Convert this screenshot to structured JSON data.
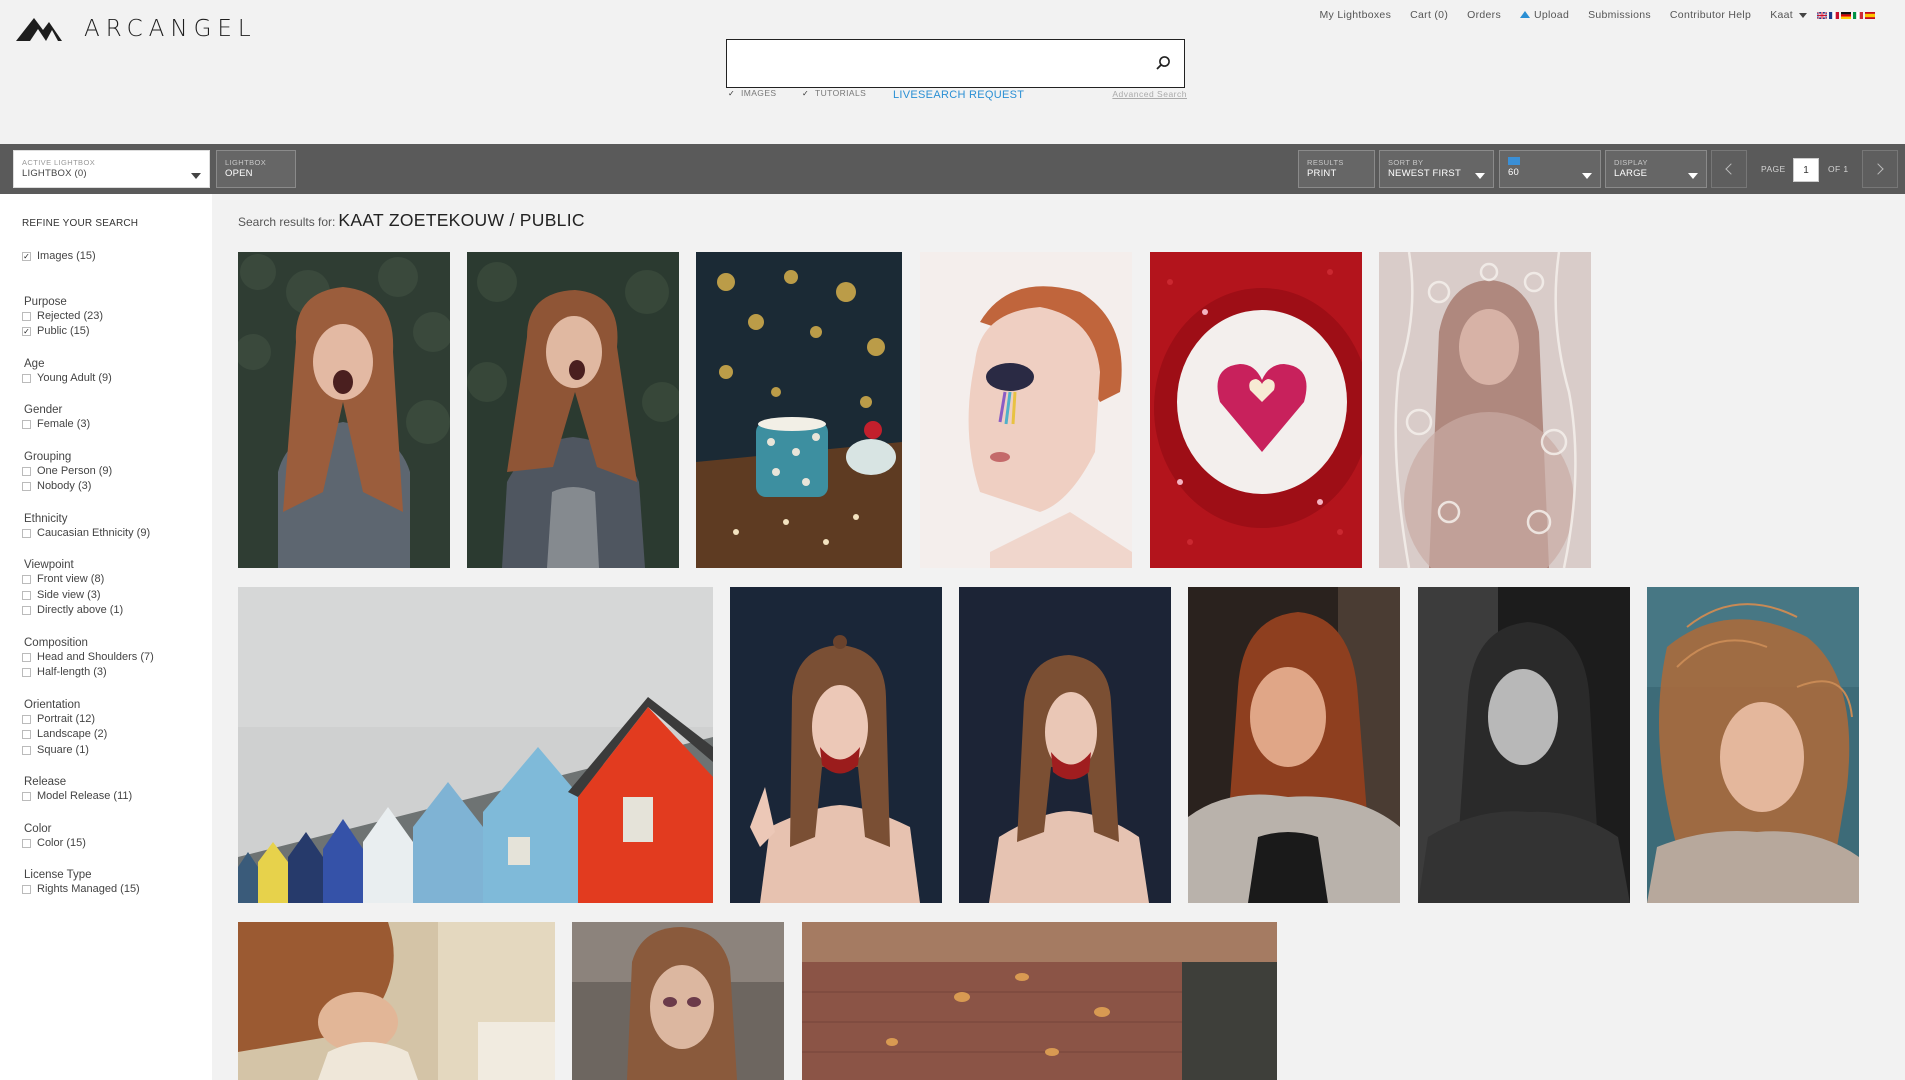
{
  "brand": {
    "name": "ARCANGEL"
  },
  "topnav": {
    "items": [
      "My Lightboxes",
      "Cart (0)",
      "Orders",
      "Upload",
      "Submissions",
      "Contributor Help"
    ],
    "user": "Kaat"
  },
  "search": {
    "placeholder": "",
    "value": "",
    "options": [
      {
        "label": "IMAGES",
        "checked": true
      },
      {
        "label": "TUTORIALS",
        "checked": true
      }
    ],
    "livesearch_label": "LIVESEARCH REQUEST",
    "advanced_label": "Advanced Search"
  },
  "toolbar": {
    "lightbox": {
      "label": "ACTIVE LIGHTBOX",
      "value": "LIGHTBOX (0)"
    },
    "lightbox_open": {
      "label": "LIGHTBOX",
      "value": "OPEN"
    },
    "results": {
      "label": "RESULTS",
      "value": "PRINT"
    },
    "sort": {
      "label": "SORT BY",
      "value": "NEWEST FIRST"
    },
    "per_page": {
      "value": "60"
    },
    "display": {
      "label": "DISPLAY",
      "value": "LARGE"
    },
    "page_label": "PAGE",
    "page_current": "1",
    "page_total": "OF 1"
  },
  "sidebar": {
    "title": "REFINE YOUR SEARCH",
    "top_item": {
      "label": "Images (15)",
      "checked": true
    },
    "facets": [
      {
        "heading": "Purpose",
        "items": [
          {
            "label": "Rejected (23)",
            "checked": false
          },
          {
            "label": "Public (15)",
            "checked": true
          }
        ]
      },
      {
        "heading": "Age",
        "items": [
          {
            "label": "Young Adult (9)",
            "checked": false
          }
        ]
      },
      {
        "heading": "Gender",
        "items": [
          {
            "label": "Female (3)",
            "checked": false
          }
        ]
      },
      {
        "heading": "Grouping",
        "items": [
          {
            "label": "One Person (9)",
            "checked": false
          },
          {
            "label": "Nobody (3)",
            "checked": false
          }
        ]
      },
      {
        "heading": "Ethnicity",
        "items": [
          {
            "label": "Caucasian Ethnicity (9)",
            "checked": false
          }
        ]
      },
      {
        "heading": "Viewpoint",
        "items": [
          {
            "label": "Front view (8)",
            "checked": false
          },
          {
            "label": "Side view (3)",
            "checked": false
          },
          {
            "label": "Directly above (1)",
            "checked": false
          }
        ]
      },
      {
        "heading": "Composition",
        "items": [
          {
            "label": "Head and Shoulders (7)",
            "checked": false
          },
          {
            "label": "Half-length (3)",
            "checked": false
          }
        ]
      },
      {
        "heading": "Orientation",
        "items": [
          {
            "label": "Portrait (12)",
            "checked": false
          },
          {
            "label": "Landscape (2)",
            "checked": false
          },
          {
            "label": "Square (1)",
            "checked": false
          }
        ]
      },
      {
        "heading": "Release",
        "items": [
          {
            "label": "Model Release (11)",
            "checked": false
          }
        ]
      },
      {
        "heading": "Color",
        "items": [
          {
            "label": "Color (15)",
            "checked": false
          }
        ]
      },
      {
        "heading": "License Type",
        "items": [
          {
            "label": "Rights Managed (15)",
            "checked": false
          }
        ]
      }
    ]
  },
  "results": {
    "prefix": "Search results for:",
    "query": "KAAT ZOETEKOUW / PUBLIC"
  },
  "colors": {
    "toolbar_bg": "#5a5a5a",
    "accent_blue": "#2a8fd4"
  }
}
